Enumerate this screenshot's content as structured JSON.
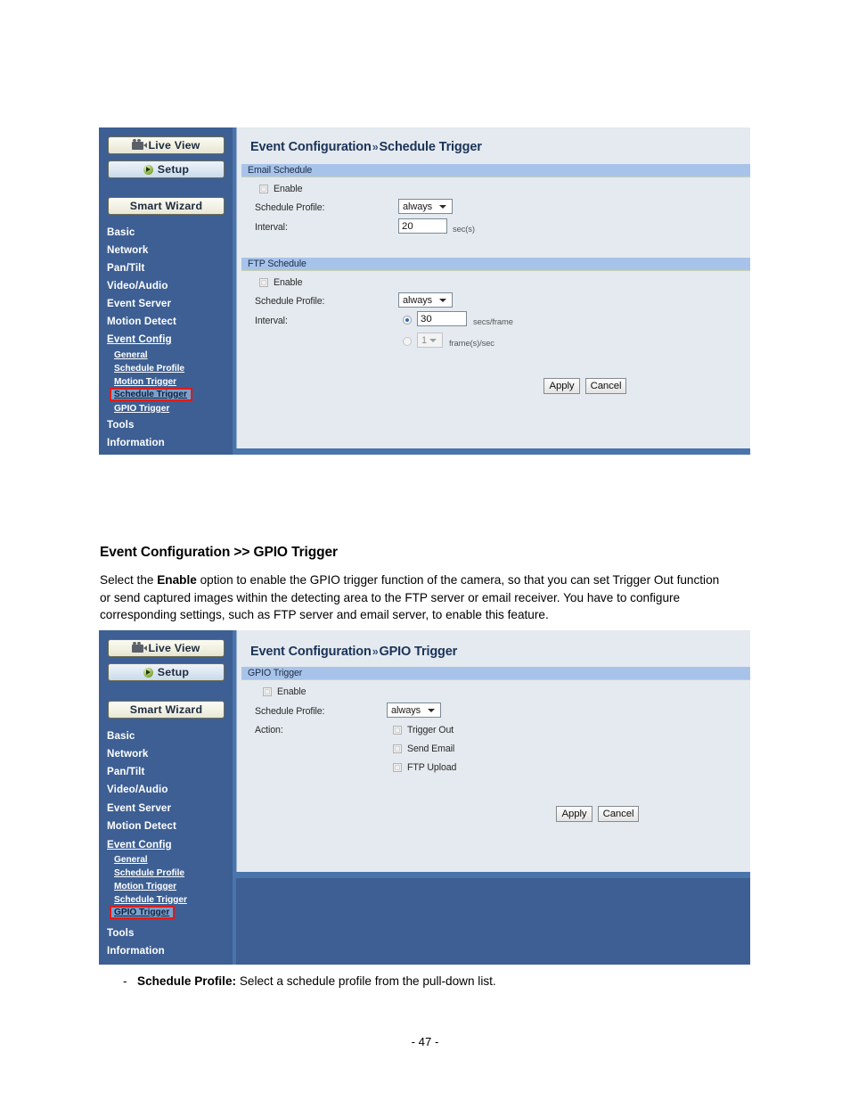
{
  "panel1": {
    "title_main": "Event Configuration",
    "title_sep": "»",
    "title_sub": "Schedule Trigger",
    "nav": {
      "live_view": "Live View",
      "setup": "Setup",
      "smart_wizard": "Smart Wizard"
    },
    "menu": [
      "Basic",
      "Network",
      "Pan/Tilt",
      "Video/Audio",
      "Event Server",
      "Motion Detect",
      "Event Config"
    ],
    "submenu": [
      "General",
      "Schedule Profile",
      "Motion Trigger",
      "Schedule Trigger",
      "GPIO Trigger"
    ],
    "selected_submenu": "Schedule Trigger",
    "menu_tail": [
      "Tools",
      "Information"
    ],
    "email_section": {
      "header": "Email Schedule",
      "enable_label": "Enable",
      "enable_checked": false,
      "schedule_profile_label": "Schedule Profile:",
      "schedule_profile_value": "always",
      "interval_label": "Interval:",
      "interval_value": "20",
      "interval_unit": "sec(s)"
    },
    "ftp_section": {
      "header": "FTP Schedule",
      "enable_label": "Enable",
      "enable_checked": false,
      "schedule_profile_label": "Schedule Profile:",
      "schedule_profile_value": "always",
      "interval_label": "Interval:",
      "secs_value": "30",
      "secs_unit": "secs/frame",
      "fps_value": "1",
      "fps_unit": "frame(s)/sec"
    },
    "apply_label": "Apply",
    "cancel_label": "Cancel"
  },
  "section_heading": "Event Configuration >> GPIO Trigger",
  "section_paragraph": {
    "part1": "Select the ",
    "bold1": "Enable",
    "part2": " option to enable the GPIO trigger function of the camera, so that you can set Trigger Out function or send captured images within the detecting area to the FTP server or email receiver. You have to configure corresponding settings, such as FTP server and email server, to enable this feature."
  },
  "panel2": {
    "title_main": "Event Configuration",
    "title_sep": "»",
    "title_sub": "GPIO Trigger",
    "nav": {
      "live_view": "Live View",
      "setup": "Setup",
      "smart_wizard": "Smart Wizard"
    },
    "menu": [
      "Basic",
      "Network",
      "Pan/Tilt",
      "Video/Audio",
      "Event Server",
      "Motion Detect",
      "Event Config"
    ],
    "submenu": [
      "General",
      "Schedule Profile",
      "Motion Trigger",
      "Schedule Trigger",
      "GPIO Trigger"
    ],
    "selected_submenu": "GPIO Trigger",
    "menu_tail": [
      "Tools",
      "Information"
    ],
    "gpio_section": {
      "header": "GPIO Trigger",
      "enable_label": "Enable",
      "enable_checked": false,
      "schedule_profile_label": "Schedule Profile:",
      "schedule_profile_value": "always",
      "action_label": "Action:",
      "actions": [
        {
          "label": "Trigger Out",
          "checked": false
        },
        {
          "label": "Send Email",
          "checked": false
        },
        {
          "label": "FTP Upload",
          "checked": false
        }
      ]
    },
    "apply_label": "Apply",
    "cancel_label": "Cancel"
  },
  "bullet": {
    "dash": "-",
    "term": "Schedule Profile:",
    "text": " Select a schedule profile from the pull-down list."
  },
  "page_number": "- 47 -",
  "colors": {
    "sidebar": "#3d5f93",
    "content_bg": "#e4eaef",
    "section_bar": "#a8c3ea",
    "accent_bar": "#4a74ac",
    "highlight": "#7ba0cc",
    "selection_outline": "#e01b18",
    "title_text": "#1b3358"
  }
}
